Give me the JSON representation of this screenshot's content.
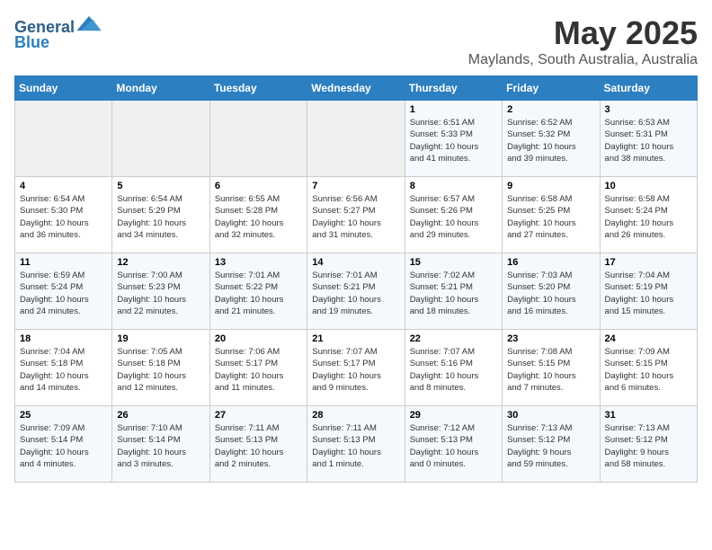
{
  "logo": {
    "text_general": "General",
    "text_blue": "Blue"
  },
  "title": "May 2025",
  "subtitle": "Maylands, South Australia, Australia",
  "days_of_week": [
    "Sunday",
    "Monday",
    "Tuesday",
    "Wednesday",
    "Thursday",
    "Friday",
    "Saturday"
  ],
  "weeks": [
    [
      {
        "day": "",
        "info": ""
      },
      {
        "day": "",
        "info": ""
      },
      {
        "day": "",
        "info": ""
      },
      {
        "day": "",
        "info": ""
      },
      {
        "day": "1",
        "info": "Sunrise: 6:51 AM\nSunset: 5:33 PM\nDaylight: 10 hours\nand 41 minutes."
      },
      {
        "day": "2",
        "info": "Sunrise: 6:52 AM\nSunset: 5:32 PM\nDaylight: 10 hours\nand 39 minutes."
      },
      {
        "day": "3",
        "info": "Sunrise: 6:53 AM\nSunset: 5:31 PM\nDaylight: 10 hours\nand 38 minutes."
      }
    ],
    [
      {
        "day": "4",
        "info": "Sunrise: 6:54 AM\nSunset: 5:30 PM\nDaylight: 10 hours\nand 36 minutes."
      },
      {
        "day": "5",
        "info": "Sunrise: 6:54 AM\nSunset: 5:29 PM\nDaylight: 10 hours\nand 34 minutes."
      },
      {
        "day": "6",
        "info": "Sunrise: 6:55 AM\nSunset: 5:28 PM\nDaylight: 10 hours\nand 32 minutes."
      },
      {
        "day": "7",
        "info": "Sunrise: 6:56 AM\nSunset: 5:27 PM\nDaylight: 10 hours\nand 31 minutes."
      },
      {
        "day": "8",
        "info": "Sunrise: 6:57 AM\nSunset: 5:26 PM\nDaylight: 10 hours\nand 29 minutes."
      },
      {
        "day": "9",
        "info": "Sunrise: 6:58 AM\nSunset: 5:25 PM\nDaylight: 10 hours\nand 27 minutes."
      },
      {
        "day": "10",
        "info": "Sunrise: 6:58 AM\nSunset: 5:24 PM\nDaylight: 10 hours\nand 26 minutes."
      }
    ],
    [
      {
        "day": "11",
        "info": "Sunrise: 6:59 AM\nSunset: 5:24 PM\nDaylight: 10 hours\nand 24 minutes."
      },
      {
        "day": "12",
        "info": "Sunrise: 7:00 AM\nSunset: 5:23 PM\nDaylight: 10 hours\nand 22 minutes."
      },
      {
        "day": "13",
        "info": "Sunrise: 7:01 AM\nSunset: 5:22 PM\nDaylight: 10 hours\nand 21 minutes."
      },
      {
        "day": "14",
        "info": "Sunrise: 7:01 AM\nSunset: 5:21 PM\nDaylight: 10 hours\nand 19 minutes."
      },
      {
        "day": "15",
        "info": "Sunrise: 7:02 AM\nSunset: 5:21 PM\nDaylight: 10 hours\nand 18 minutes."
      },
      {
        "day": "16",
        "info": "Sunrise: 7:03 AM\nSunset: 5:20 PM\nDaylight: 10 hours\nand 16 minutes."
      },
      {
        "day": "17",
        "info": "Sunrise: 7:04 AM\nSunset: 5:19 PM\nDaylight: 10 hours\nand 15 minutes."
      }
    ],
    [
      {
        "day": "18",
        "info": "Sunrise: 7:04 AM\nSunset: 5:18 PM\nDaylight: 10 hours\nand 14 minutes."
      },
      {
        "day": "19",
        "info": "Sunrise: 7:05 AM\nSunset: 5:18 PM\nDaylight: 10 hours\nand 12 minutes."
      },
      {
        "day": "20",
        "info": "Sunrise: 7:06 AM\nSunset: 5:17 PM\nDaylight: 10 hours\nand 11 minutes."
      },
      {
        "day": "21",
        "info": "Sunrise: 7:07 AM\nSunset: 5:17 PM\nDaylight: 10 hours\nand 9 minutes."
      },
      {
        "day": "22",
        "info": "Sunrise: 7:07 AM\nSunset: 5:16 PM\nDaylight: 10 hours\nand 8 minutes."
      },
      {
        "day": "23",
        "info": "Sunrise: 7:08 AM\nSunset: 5:15 PM\nDaylight: 10 hours\nand 7 minutes."
      },
      {
        "day": "24",
        "info": "Sunrise: 7:09 AM\nSunset: 5:15 PM\nDaylight: 10 hours\nand 6 minutes."
      }
    ],
    [
      {
        "day": "25",
        "info": "Sunrise: 7:09 AM\nSunset: 5:14 PM\nDaylight: 10 hours\nand 4 minutes."
      },
      {
        "day": "26",
        "info": "Sunrise: 7:10 AM\nSunset: 5:14 PM\nDaylight: 10 hours\nand 3 minutes."
      },
      {
        "day": "27",
        "info": "Sunrise: 7:11 AM\nSunset: 5:13 PM\nDaylight: 10 hours\nand 2 minutes."
      },
      {
        "day": "28",
        "info": "Sunrise: 7:11 AM\nSunset: 5:13 PM\nDaylight: 10 hours\nand 1 minute."
      },
      {
        "day": "29",
        "info": "Sunrise: 7:12 AM\nSunset: 5:13 PM\nDaylight: 10 hours\nand 0 minutes."
      },
      {
        "day": "30",
        "info": "Sunrise: 7:13 AM\nSunset: 5:12 PM\nDaylight: 9 hours\nand 59 minutes."
      },
      {
        "day": "31",
        "info": "Sunrise: 7:13 AM\nSunset: 5:12 PM\nDaylight: 9 hours\nand 58 minutes."
      }
    ]
  ]
}
